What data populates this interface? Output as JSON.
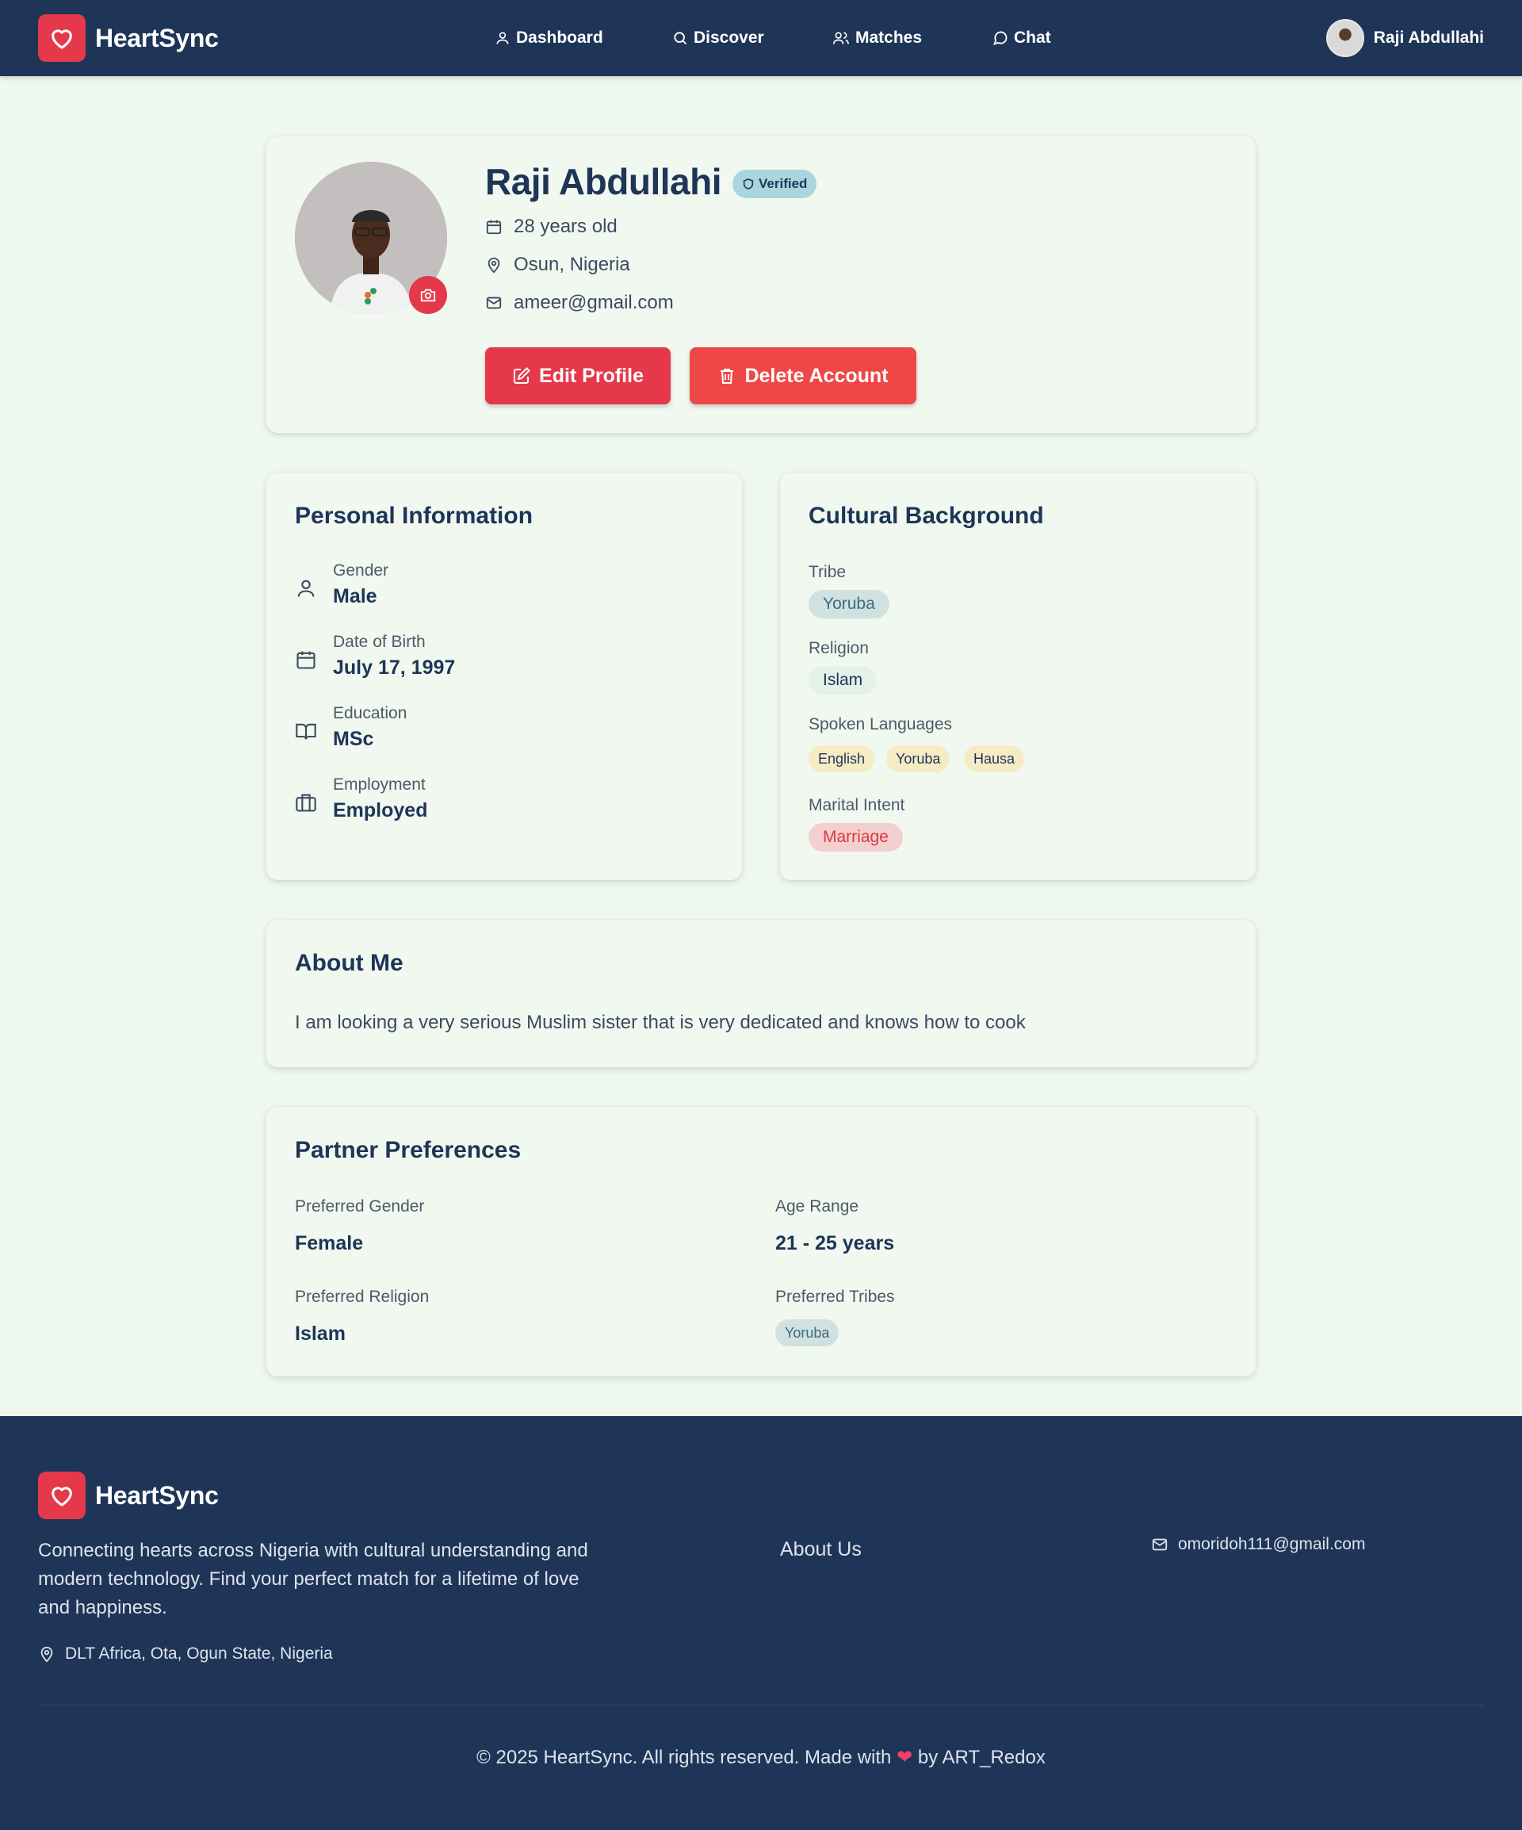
{
  "header": {
    "brand": "HeartSync",
    "nav": [
      {
        "label": "Dashboard",
        "icon": "user-icon"
      },
      {
        "label": "Discover",
        "icon": "search-icon"
      },
      {
        "label": "Matches",
        "icon": "users-icon"
      },
      {
        "label": "Chat",
        "icon": "message-circle-icon"
      }
    ],
    "user_name": "Raji Abdullahi"
  },
  "profile": {
    "name": "Raji Abdullahi",
    "verified_label": "Verified",
    "age": "28 years old",
    "location": "Osun, Nigeria",
    "email": "ameer@gmail.com",
    "edit_label": "Edit Profile",
    "delete_label": "Delete Account"
  },
  "personal_info": {
    "title": "Personal Information",
    "rows": [
      {
        "label": "Gender",
        "value": "Male",
        "icon": "user-icon"
      },
      {
        "label": "Date of Birth",
        "value": "July 17, 1997",
        "icon": "calendar-icon"
      },
      {
        "label": "Education",
        "value": "MSc",
        "icon": "book-open-icon"
      },
      {
        "label": "Employment",
        "value": "Employed",
        "icon": "briefcase-icon"
      }
    ]
  },
  "cultural": {
    "title": "Cultural Background",
    "tribe_label": "Tribe",
    "tribe": "Yoruba",
    "religion_label": "Religion",
    "religion": "Islam",
    "languages_label": "Spoken Languages",
    "languages": [
      "English",
      "Yoruba",
      "Hausa"
    ],
    "intent_label": "Marital Intent",
    "intent": "Marriage"
  },
  "about": {
    "title": "About Me",
    "text": "I am looking a very serious Muslim sister that is very dedicated and knows how to cook"
  },
  "preferences": {
    "title": "Partner Preferences",
    "gender_label": "Preferred Gender",
    "gender": "Female",
    "age_label": "Age Range",
    "age": "21 - 25 years",
    "religion_label": "Preferred Religion",
    "religion": "Islam",
    "tribes_label": "Preferred Tribes",
    "tribes": [
      "Yoruba"
    ]
  },
  "footer": {
    "brand": "HeartSync",
    "description": "Connecting hearts across Nigeria with cultural understanding and modern technology. Find your perfect match for a lifetime of love and happiness.",
    "location": "DLT Africa, Ota, Ogun State, Nigeria",
    "about_link": "About Us",
    "email": "omoridoh111@gmail.com",
    "copyright_pre": "© 2025 HeartSync. All rights reserved. Made with",
    "copyright_post": "by ART_Redox"
  },
  "colors": {
    "navy": "#1e3557",
    "accent_red": "#e5384a",
    "page_bg": "#eff8ef",
    "verified_bg": "#a9d6dc",
    "tribe_bg": "#cfe1e1",
    "language_bg": "#f6ecc4",
    "intent_bg": "#f4cfcf"
  }
}
